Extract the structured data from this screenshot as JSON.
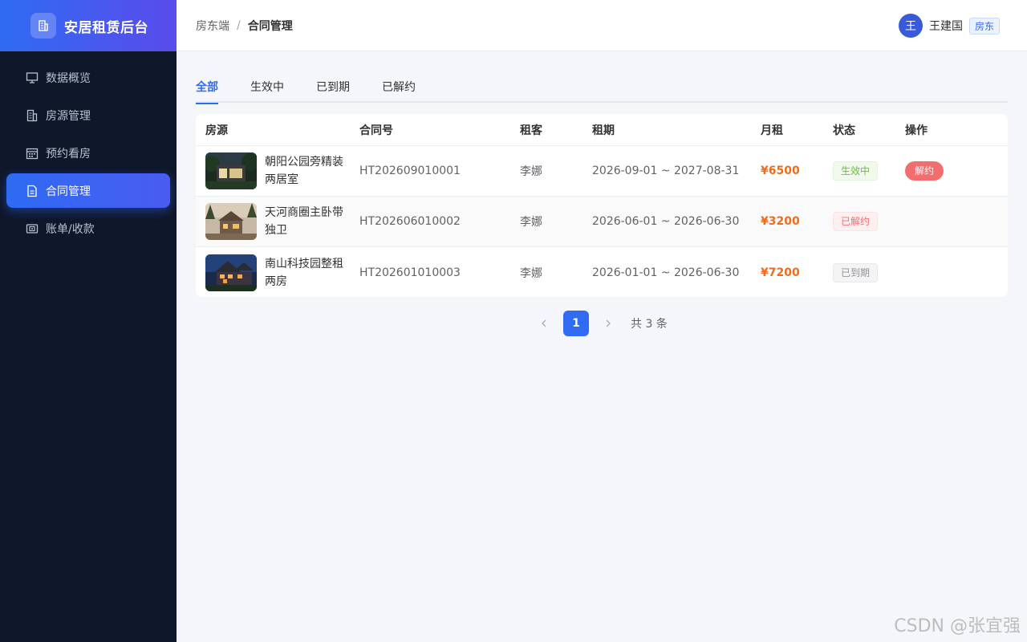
{
  "app": {
    "title": "安居租赁后台"
  },
  "sidebar": {
    "items": [
      {
        "label": "数据概览",
        "icon": "dashboard-icon",
        "active": false
      },
      {
        "label": "房源管理",
        "icon": "building-icon",
        "active": false
      },
      {
        "label": "预约看房",
        "icon": "calendar-icon",
        "active": false
      },
      {
        "label": "合同管理",
        "icon": "document-icon",
        "active": true
      },
      {
        "label": "账单/收款",
        "icon": "wallet-icon",
        "active": false
      }
    ]
  },
  "header": {
    "breadcrumb_parent": "房东端",
    "breadcrumb_separator": "/",
    "breadcrumb_current": "合同管理",
    "user": {
      "avatar_text": "王",
      "name": "王建国",
      "role": "房东"
    }
  },
  "tabs": [
    {
      "label": "全部",
      "active": true
    },
    {
      "label": "生效中",
      "active": false
    },
    {
      "label": "已到期",
      "active": false
    },
    {
      "label": "已解约",
      "active": false
    }
  ],
  "table": {
    "columns": [
      "房源",
      "合同号",
      "租客",
      "租期",
      "月租",
      "状态",
      "操作"
    ],
    "rows": [
      {
        "property": "朝阳公园旁精装两居室",
        "contract_no": "HT202609010001",
        "tenant": "李娜",
        "term": "2026-09-01 ~ 2027-08-31",
        "rent": "¥6500",
        "status": "生效中",
        "status_color": "green",
        "action": "解约"
      },
      {
        "property": "天河商圈主卧带独卫",
        "contract_no": "HT202606010002",
        "tenant": "李娜",
        "term": "2026-06-01 ~ 2026-06-30",
        "rent": "¥3200",
        "status": "已解约",
        "status_color": "red",
        "action": ""
      },
      {
        "property": "南山科技园整租两房",
        "contract_no": "HT202601010003",
        "tenant": "李娜",
        "term": "2026-01-01 ~ 2026-06-30",
        "rent": "¥7200",
        "status": "已到期",
        "status_color": "gray",
        "action": ""
      }
    ]
  },
  "pagination": {
    "current_page": "1",
    "total_text": "共 3 条"
  },
  "watermark": "CSDN @张宜强",
  "colors": {
    "primary": "#2f6bf3",
    "sidebar_bg": "#0f172a",
    "rent": "#f06b1a",
    "danger": "#f26d6d"
  }
}
